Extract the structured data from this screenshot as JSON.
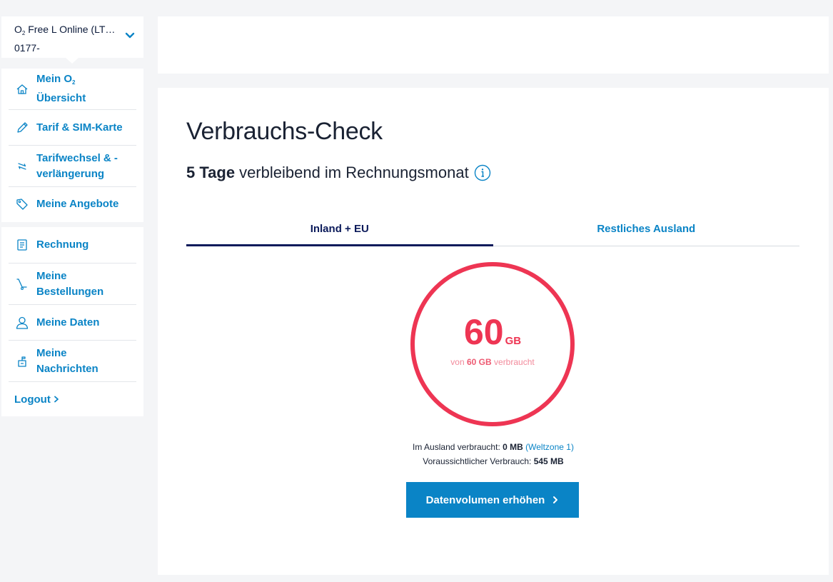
{
  "contract": {
    "name_prefix": "O",
    "name_sub": "2",
    "name_rest": " Free L Online (LT…",
    "number": "0177-"
  },
  "nav": {
    "group1": [
      {
        "label_prefix": "Mein O",
        "label_sub": "2",
        "label_line2": "Übersicht",
        "icon": "home-icon"
      },
      {
        "label": "Tarif & SIM-Karte",
        "icon": "pencil-icon"
      },
      {
        "label_line1": "Tarifwechsel & -",
        "label_line2": "verlängerung",
        "icon": "swap-arrows-icon"
      },
      {
        "label": "Meine Angebote",
        "icon": "tag-icon"
      }
    ],
    "group2": [
      {
        "label": "Rechnung",
        "icon": "invoice-icon"
      },
      {
        "label_line1": "Meine",
        "label_line2": "Bestellungen",
        "icon": "trolley-icon"
      },
      {
        "label": "Meine Daten",
        "icon": "user-icon"
      },
      {
        "label_line1": "Meine",
        "label_line2": "Nachrichten",
        "icon": "mailbox-icon"
      }
    ],
    "logout": "Logout"
  },
  "main": {
    "title": "Verbrauchs-Check",
    "days_bold": "5 Tage",
    "days_rest": "verbleibend im Rechnungsmonat",
    "tabs": [
      {
        "label": "Inland + EU",
        "active": true
      },
      {
        "label": "Restliches Ausland",
        "active": false
      }
    ],
    "gauge": {
      "used_value": "60",
      "used_unit": "GB",
      "text_prefix": "von",
      "total": "60 GB",
      "text_suffix": "verbraucht",
      "used_fraction": 1.0,
      "color": "#ee3553"
    },
    "abroad_label": "Im Ausland verbraucht:",
    "abroad_value": "0 MB",
    "abroad_zone": "(Weltzone 1)",
    "forecast_label": "Voraussichtlicher Verbrauch:",
    "forecast_value": "545 MB",
    "cta_label": "Datenvolumen erhöhen"
  },
  "colors": {
    "accent": "#0a84c6",
    "navy": "#0b1a5a",
    "alert": "#ee3553"
  }
}
